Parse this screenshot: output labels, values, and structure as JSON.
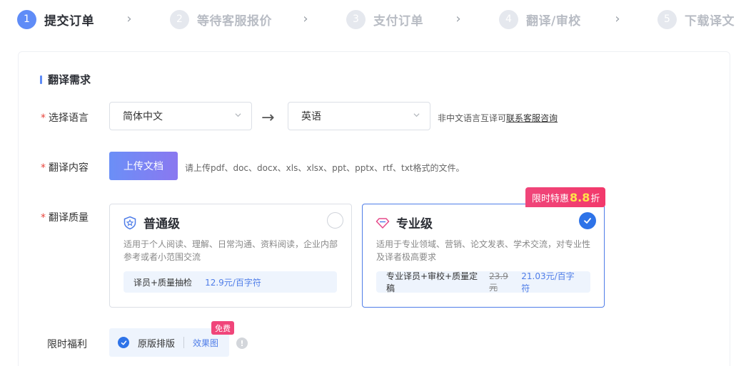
{
  "steps": [
    {
      "num": "1",
      "label": "提交订单",
      "active": true
    },
    {
      "num": "2",
      "label": "等待客服报价",
      "active": false
    },
    {
      "num": "3",
      "label": "支付订单",
      "active": false
    },
    {
      "num": "4",
      "label": "翻译/审校",
      "active": false
    },
    {
      "num": "5",
      "label": "下载译文",
      "active": false
    }
  ],
  "step_separator": "›",
  "section_title": "翻译需求",
  "required_mark": "*",
  "language": {
    "label": "选择语言",
    "source": "简体中文",
    "target": "英语",
    "arrow": "→",
    "hint_prefix": "非中文语言互译可",
    "hint_link": "联系客服咨询"
  },
  "content": {
    "label": "翻译内容",
    "upload_button": "上传文档",
    "upload_hint": "请上传pdf、doc、docx、xls、xlsx、ppt、pptx、rtf、txt格式的文件。"
  },
  "quality": {
    "label": "翻译质量",
    "promo": {
      "prefix": "限时特惠",
      "discount": "8.8",
      "suffix": "折"
    },
    "standard": {
      "title": "普通级",
      "desc": "适用于个人阅读、理解、日常沟通、资料阅读，企业内部参考或者小范围交流",
      "service": "译员+质量抽检",
      "price": "12.9元/百字符",
      "selected": false
    },
    "professional": {
      "title": "专业级",
      "desc": "适用于专业领域、营销、论文发表、学术交流，对专业性及译者极高要求",
      "service": "专业译员+审校+质量定稿",
      "old_price": "23.9元",
      "new_price": "21.03元/百字符",
      "selected": true
    }
  },
  "benefit": {
    "label": "限时福利",
    "option": "原版排版",
    "link": "效果图",
    "free_tag": "免费",
    "info": "!"
  },
  "colors": {
    "accent": "#5f8cf7",
    "selected_blue": "#2e73e8",
    "promo_pink": "#f0457a",
    "required_red": "#e8453c"
  }
}
